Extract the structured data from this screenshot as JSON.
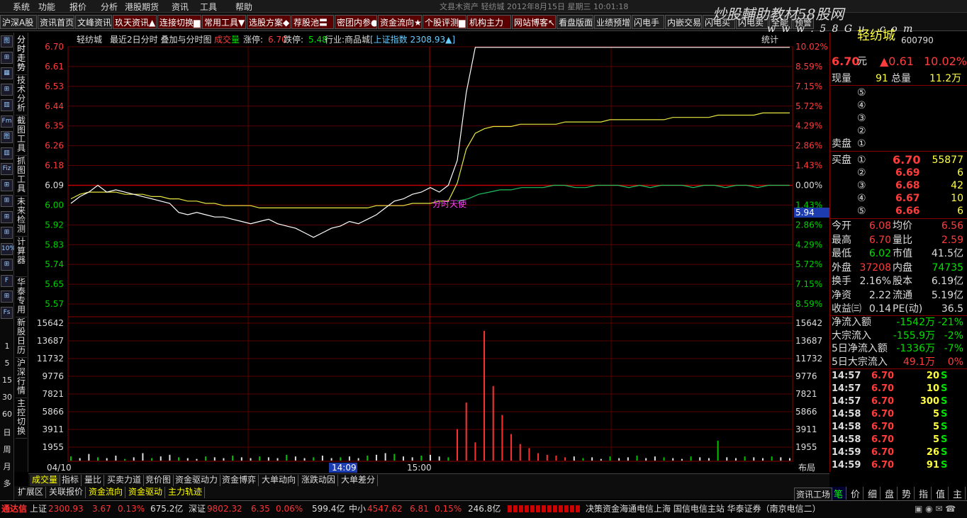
{
  "menu": [
    "系统",
    "功能",
    "报价",
    "分析",
    "港股期货",
    "资讯",
    "工具",
    "帮助"
  ],
  "window_title": "文县木资产   轻纺城  2012年8月15日  星期三  10:01:18",
  "watermark": "炒股輔助教材58股网",
  "watermark_url": "w w w . 5 8 G u . c o m",
  "tabs": [
    "沪深A股",
    "资讯首页",
    "文峰资讯",
    "玖天资讯▲",
    "连接切换▆",
    "常用工具▼",
    "选股方案◆",
    "荐股池〓",
    "密团内参●",
    "资金流向★",
    "个股评测▆",
    "机构主力",
    "网站博客↖",
    "看盘版面",
    "业绩预增",
    "闪电手",
    "内嵌交易",
    "闪电买",
    "闪电卖",
    "全能",
    "预警"
  ],
  "left_icons": [
    "图",
    "⊞",
    "▦",
    "⊞",
    "▥",
    "Fm",
    "图",
    "▥",
    "Fiz",
    "⊞",
    "⊞",
    "⊞",
    "⊞",
    "10%",
    "⊞",
    "F",
    "⊞",
    "Fs"
  ],
  "left_numbers": [
    "1",
    "5",
    "15",
    "30",
    "60",
    "日",
    "周",
    "月",
    "多"
  ],
  "vtabs": [
    "分时走势",
    "技术分析",
    "截图工具",
    "抓图工具",
    "未来检测",
    "计算器",
    "华泰专用",
    "新股日历",
    "沪深行情",
    "主控切换"
  ],
  "chart_header": {
    "stock": "轻纺城",
    "mode": "最近2日分时 叠加与分时图",
    "vol_label_red": "成交",
    "vol_label_green": "量",
    "limit_up_label": "涨停:",
    "limit_up": "6.70",
    "limit_down_label": "跌停:",
    "limit_down": "5.48",
    "industry": "行业:商品城",
    "index": "[上证指数 2308.93▲]",
    "stats": "统计"
  },
  "chart_data": {
    "type": "line",
    "price_ticks": [
      "6.70",
      "6.61",
      "6.53",
      "6.44",
      "6.35",
      "6.26",
      "6.18",
      "6.09",
      "6.00",
      "5.92",
      "5.83",
      "5.74",
      "5.65",
      "5.57"
    ],
    "pct_ticks": [
      "10.02%",
      "8.59%",
      "7.15%",
      "5.72%",
      "4.29%",
      "2.86%",
      "1.43%",
      "0.00%",
      "1.43%",
      "2.86%",
      "4.29%",
      "5.72%",
      "7.15%",
      "8.59%"
    ],
    "vol_ticks": [
      "15642",
      "13687",
      "11732",
      "9776",
      "7821",
      "5866",
      "3911",
      "1955"
    ],
    "time_labels": [
      "04/10",
      "14:09",
      "15:00"
    ],
    "crosshair_value": "5.94",
    "annotation": "分时天使",
    "price": [
      6.01,
      6.04,
      6.06,
      6.09,
      6.06,
      6.07,
      6.06,
      6.05,
      6.04,
      6.03,
      6.02,
      6.01,
      5.97,
      5.96,
      5.97,
      5.96,
      5.95,
      5.95,
      5.94,
      5.93,
      5.92,
      5.93,
      5.94,
      5.92,
      5.91,
      5.9,
      5.88,
      5.86,
      5.88,
      5.9,
      5.91,
      5.93,
      5.92,
      5.94,
      5.96,
      5.99,
      6.02,
      6.03,
      6.05,
      6.06,
      6.08,
      6.06,
      6.09,
      6.2,
      6.5,
      6.7,
      6.7,
      6.7,
      6.7,
      6.7,
      6.7,
      6.7,
      6.7,
      6.7,
      6.7,
      6.7,
      6.7,
      6.7,
      6.7,
      6.7,
      6.7,
      6.7,
      6.7,
      6.7,
      6.7,
      6.7,
      6.7,
      6.7,
      6.7,
      6.7,
      6.7,
      6.7,
      6.7,
      6.7,
      6.7,
      6.7,
      6.7,
      6.7,
      6.7,
      6.7,
      6.7
    ],
    "avg": [
      6.03,
      6.05,
      6.06,
      6.06,
      6.06,
      6.06,
      6.05,
      6.05,
      6.05,
      6.04,
      6.04,
      6.03,
      6.03,
      6.02,
      6.02,
      6.01,
      6.01,
      6.0,
      6.0,
      6.0,
      6.0,
      5.99,
      5.99,
      5.99,
      5.99,
      5.99,
      5.99,
      5.99,
      5.99,
      5.99,
      5.99,
      5.99,
      5.99,
      5.99,
      6.0,
      6.0,
      6.0,
      6.0,
      6.01,
      6.01,
      6.01,
      6.02,
      6.02,
      6.1,
      6.25,
      6.32,
      6.34,
      6.35,
      6.35,
      6.35,
      6.36,
      6.36,
      6.36,
      6.36,
      6.36,
      6.37,
      6.37,
      6.37,
      6.37,
      6.37,
      6.38,
      6.38,
      6.38,
      6.38,
      6.38,
      6.38,
      6.38,
      6.39,
      6.39,
      6.39,
      6.39,
      6.39,
      6.4,
      6.4,
      6.4,
      6.4,
      6.4,
      6.41,
      6.41,
      6.41,
      6.41
    ],
    "index_line": [
      6.02,
      6.03,
      6.05,
      6.06,
      6.07,
      6.07,
      6.08,
      6.08,
      6.08,
      6.09,
      6.09,
      6.08,
      6.08,
      6.09,
      6.09,
      6.09,
      6.08,
      6.09,
      6.08,
      6.09,
      6.09,
      6.09,
      6.08,
      6.09,
      6.09,
      6.08,
      6.09,
      6.09,
      6.08,
      6.09,
      6.09,
      6.09
    ],
    "volume": [
      500,
      300,
      800,
      400,
      300,
      600,
      200,
      400,
      900,
      300,
      500,
      700,
      400,
      300,
      200,
      500,
      400,
      300,
      600,
      400,
      300,
      500,
      400,
      300,
      700,
      500,
      300,
      400,
      600,
      300,
      400,
      500,
      300,
      600,
      700,
      900,
      800,
      500,
      400,
      600,
      700,
      500,
      400,
      3800,
      7000,
      2200,
      15642,
      9000,
      5500,
      3200,
      2000,
      1500,
      900,
      700,
      600,
      400,
      500,
      300,
      400,
      200,
      500,
      300,
      400,
      600,
      300,
      500,
      400,
      300,
      200,
      500,
      400,
      300,
      2400,
      400,
      300,
      500,
      400,
      300,
      500,
      400,
      300
    ]
  },
  "right": {
    "stock_name": "轻纺城",
    "code": "600790",
    "price": "6.70",
    "unit": "元",
    "change": "▲0.61",
    "change_pct": "10.02%",
    "now_label": "现量",
    "now_val": "91",
    "total_label": "总量",
    "total_val": "11.2万",
    "sell_label": "卖盘",
    "buy_label": "买盘",
    "sell": [
      {
        "n": "⑤",
        "p": "",
        "v": ""
      },
      {
        "n": "④",
        "p": "",
        "v": ""
      },
      {
        "n": "③",
        "p": "",
        "v": ""
      },
      {
        "n": "②",
        "p": "",
        "v": ""
      },
      {
        "n": "①",
        "p": "",
        "v": ""
      }
    ],
    "buy": [
      {
        "n": "①",
        "p": "6.70",
        "v": "55877"
      },
      {
        "n": "②",
        "p": "6.69",
        "v": "6"
      },
      {
        "n": "③",
        "p": "6.68",
        "v": "42"
      },
      {
        "n": "④",
        "p": "6.67",
        "v": "10"
      },
      {
        "n": "⑤",
        "p": "6.66",
        "v": "6"
      }
    ],
    "stats": [
      [
        "今开",
        "6.08",
        "red",
        "均价",
        "6.56",
        "red"
      ],
      [
        "最高",
        "6.70",
        "red",
        "量比",
        "2.59",
        "red"
      ],
      [
        "最低",
        "6.02",
        "green",
        "市值",
        "41.5亿",
        "w"
      ],
      [
        "外盘",
        "37208",
        "red",
        "内盘",
        "74735",
        "green"
      ],
      [
        "换手",
        "2.16%",
        "w",
        "股本",
        "6.19亿",
        "w"
      ],
      [
        "净资",
        "2.22",
        "w",
        "流通",
        "5.19亿",
        "w"
      ],
      [
        "收益㈢",
        "0.14",
        "w",
        "PE(动)",
        "36.5",
        "w"
      ]
    ],
    "flows": [
      [
        "净流入额",
        "-1542万",
        "-21%"
      ],
      [
        "大宗流入",
        "-155.9万",
        "-2%"
      ],
      [
        "5日净流入额",
        "-1336万",
        "-7%"
      ],
      [
        "5日大宗流入",
        "49.1万",
        "0%"
      ]
    ],
    "ticks": [
      [
        "14:57",
        "6.70",
        "20",
        "S"
      ],
      [
        "14:57",
        "6.70",
        "10",
        "S"
      ],
      [
        "14:57",
        "6.70",
        "300",
        "S"
      ],
      [
        "14:58",
        "6.70",
        "5",
        "S"
      ],
      [
        "14:58",
        "6.70",
        "5",
        "S"
      ],
      [
        "14:58",
        "6.70",
        "5",
        "S"
      ],
      [
        "14:59",
        "6.70",
        "26",
        "S"
      ],
      [
        "14:59",
        "6.70",
        "91",
        "S"
      ]
    ],
    "bottom_tabs": [
      "笔",
      "价",
      "细",
      "盘",
      "势",
      "指",
      "值",
      "主"
    ],
    "layout_label": "布局",
    "info_label": "资讯工场"
  },
  "bottom_tabs": [
    "成交量",
    "指标",
    "量比",
    "买卖力道",
    "竞价图",
    "资金驱动力",
    "资金博弈",
    "大单动向",
    "涨跌动因",
    "大单差分"
  ],
  "bottom_tabs2": [
    "扩展区",
    "关联报价",
    "资金流向",
    "资金驱动",
    "主力轨迹"
  ],
  "status": {
    "brand": "通达信",
    "sh_label": "上证",
    "sh_val": "2300.93",
    "sh_chg": "3.67",
    "sh_pct": "0.13%",
    "sh_amt": "675.2亿",
    "sz_label": "深证",
    "sz_val": "9802.32",
    "sz_chg": "6.35",
    "sz_pct": "0.06%",
    "sz_amt": "599.4亿",
    "zx_label": "中小",
    "zx_val": "4547.62",
    "zx_chg": "6.81",
    "zx_pct": "0.15%",
    "zx_amt": "246.8亿",
    "news": "决策资金海通电信上海  国信电信主站  华泰证券（南京电信二）"
  }
}
